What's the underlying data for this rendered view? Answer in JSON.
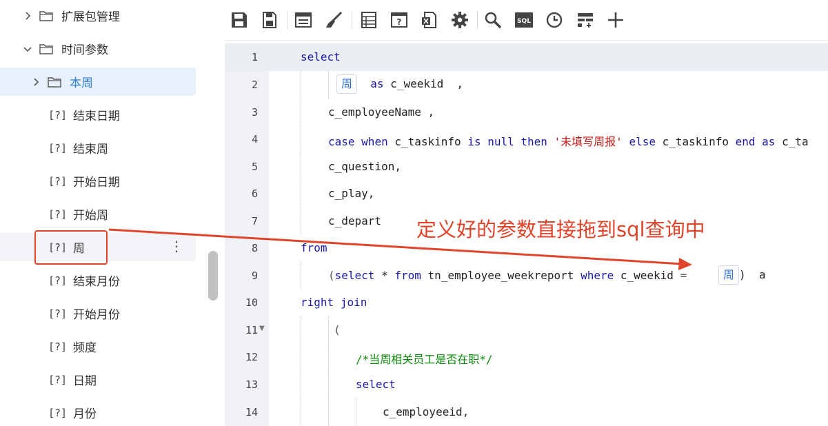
{
  "tree": {
    "items": [
      {
        "label": "扩展包管理",
        "kind": "folder",
        "expanded": false
      },
      {
        "label": "时间参数",
        "kind": "folder",
        "expanded": true
      },
      {
        "label": "本周",
        "kind": "folder",
        "expanded": false
      },
      {
        "label": "结束日期",
        "kind": "param"
      },
      {
        "label": "结束周",
        "kind": "param"
      },
      {
        "label": "开始日期",
        "kind": "param"
      },
      {
        "label": "开始周",
        "kind": "param"
      },
      {
        "label": "周",
        "kind": "param"
      },
      {
        "label": "结束月份",
        "kind": "param"
      },
      {
        "label": "开始月份",
        "kind": "param"
      },
      {
        "label": "频度",
        "kind": "param"
      },
      {
        "label": "日期",
        "kind": "param"
      },
      {
        "label": "月份",
        "kind": "param"
      }
    ],
    "param_icon": "[?]",
    "more_icon": "⋮"
  },
  "toolbar": {
    "icons": [
      "save-icon",
      "save-as-icon",
      "layout-icon",
      "brush-icon",
      "table-icon",
      "param-icon",
      "excel-icon",
      "gear-icon",
      "search-icon",
      "sql-icon",
      "clock-icon",
      "flow-icon",
      "plus-icon"
    ],
    "sql_label": "SQL"
  },
  "editor": {
    "line_numbers": [
      "1",
      "2",
      "3",
      "4",
      "5",
      "6",
      "7",
      "8",
      "9",
      "10",
      "11",
      "12",
      "13",
      "14"
    ],
    "lines": {
      "l1": {
        "t1": "select"
      },
      "l2": {
        "chip": "周",
        "t1": "as",
        "t2": " c_weekid  ,"
      },
      "l3": {
        "t1": "c_employeeName ,"
      },
      "l4": {
        "k1": "case",
        "k2": "when",
        "t1": " c_taskinfo ",
        "k3": "is",
        "k4": "null",
        "k5": "then",
        "s1": "'未填写周报'",
        "k6": "else",
        "t2": " c_taskinfo ",
        "k7": "end",
        "k8": "as",
        "t3": " c_ta"
      },
      "l5": {
        "t1": "c_question,"
      },
      "l6": {
        "t1": "c_play,"
      },
      "l7": {
        "t1": "c_depart"
      },
      "l8": {
        "t1": "from"
      },
      "l9": {
        "p1": "(",
        "k1": "select",
        "t1": " * ",
        "k2": "from",
        "t2": " tn_employee_weekreport ",
        "k3": "where",
        "t3": " c_weekid ",
        "t4": "=",
        "chip": "周",
        "t5": ")  a"
      },
      "l10": {
        "k1": "right",
        "k2": "join"
      },
      "l11": {
        "p1": "("
      },
      "l12": {
        "c1": "/*当周相关员工是否在职*/"
      },
      "l13": {
        "k1": "select"
      },
      "l14": {
        "t1": "c_employeeid,"
      }
    }
  },
  "annotation": {
    "text": "定义好的参数直接拖到sql查询中",
    "color": "#e0452b"
  },
  "colors": {
    "keyword": "#1a1aa6",
    "string": "#c41a16",
    "comment": "#0a8a0a",
    "accent": "#2f7fd8"
  }
}
